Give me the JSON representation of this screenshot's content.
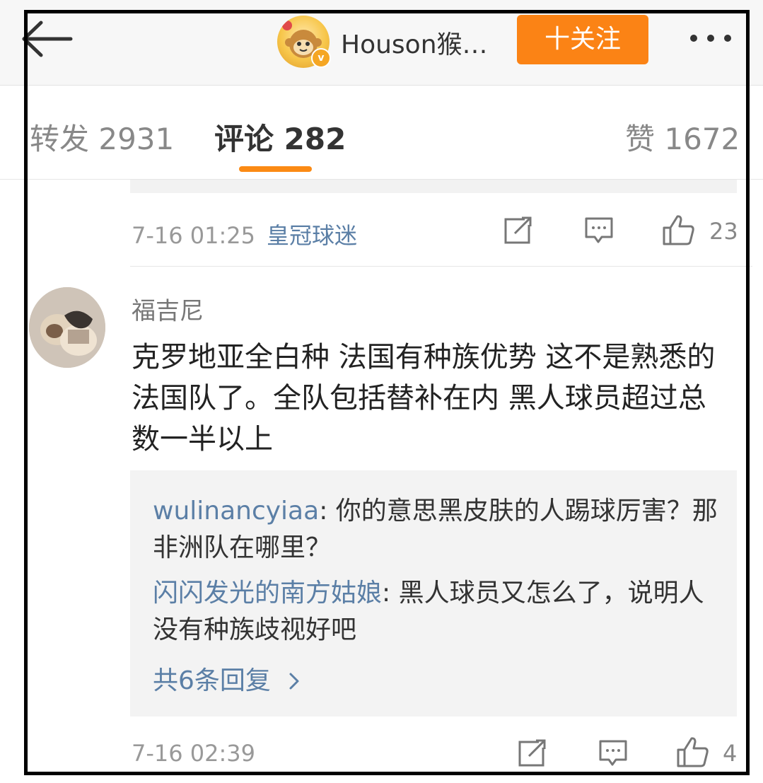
{
  "header": {
    "title": "Houson猴…",
    "follow_label": "十关注",
    "avatar_icon": "monkey-avatar",
    "verified_badge": "v"
  },
  "tabs": [
    {
      "label": "转发 2931"
    },
    {
      "label": "评论 282"
    },
    {
      "label": "赞 1672"
    }
  ],
  "comments": [
    {
      "time": "7-16 01:25",
      "source": "皇冠球迷",
      "likes": "23"
    },
    {
      "author": "福吉尼",
      "text": "克罗地亚全白种 法国有种族优势 这不是熟悉的法国队了。全队包括替补在内 黑人球员超过总数一半以上",
      "replies": [
        {
          "name": "wulinancyiaa",
          "text": ": 你的意思黑皮肤的人踢球厉害？那非洲队在哪里？"
        },
        {
          "name": "闪闪发光的南方姑娘",
          "text": ": 黑人球员又怎么了，说明人没有种族歧视好吧"
        }
      ],
      "more_replies": "共6条回复",
      "time": "7-16 02:39",
      "likes": "4"
    }
  ],
  "colors": {
    "accent_orange": "#fb8315",
    "link_blue": "#5b7fa6"
  }
}
